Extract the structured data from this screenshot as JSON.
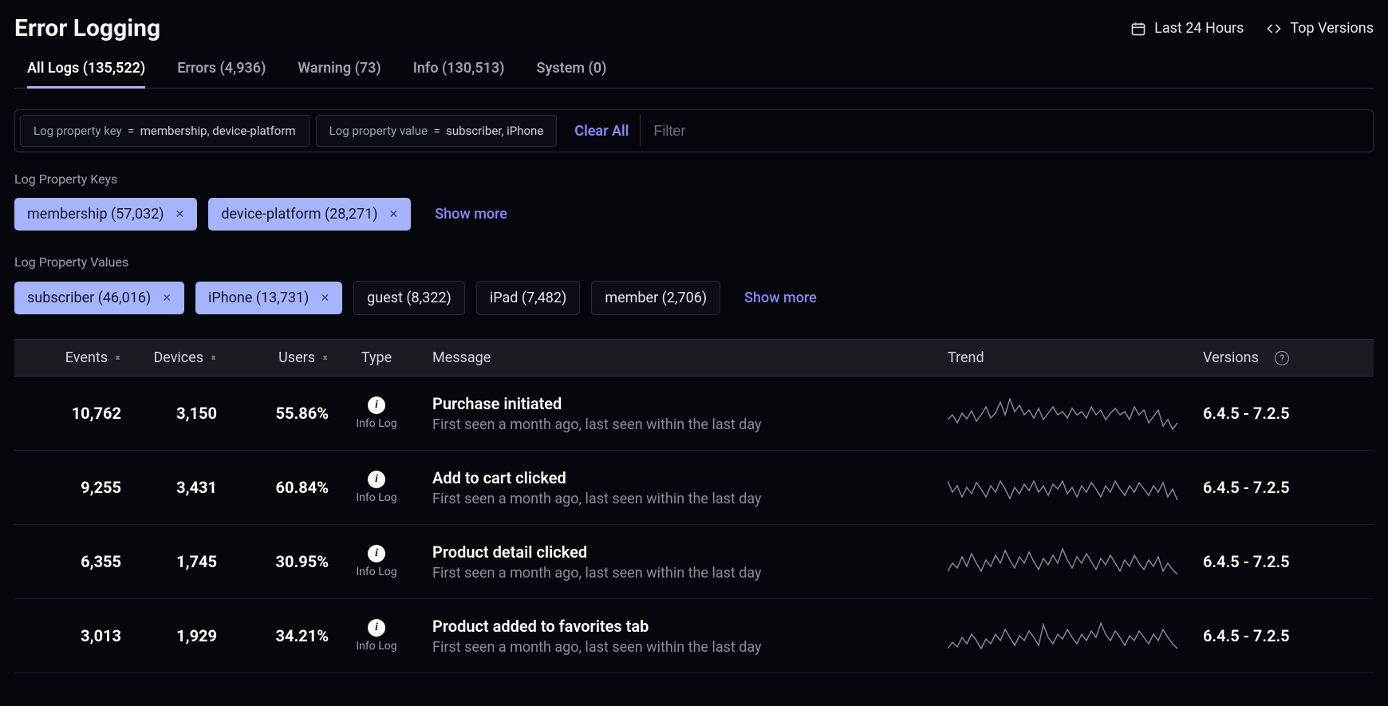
{
  "header": {
    "title": "Error Logging",
    "time_range_label": "Last 24 Hours",
    "versions_label": "Top Versions"
  },
  "tabs": [
    {
      "label": "All Logs (135,522)",
      "active": true
    },
    {
      "label": "Errors (4,936)",
      "active": false
    },
    {
      "label": "Warning (73)",
      "active": false
    },
    {
      "label": "Info (130,513)",
      "active": false
    },
    {
      "label": "System (0)",
      "active": false
    }
  ],
  "filter_bar": {
    "chips": [
      {
        "kind": "Log property key",
        "value": "membership, device-platform"
      },
      {
        "kind": "Log property value",
        "value": "subscriber, iPhone"
      }
    ],
    "clear_label": "Clear All",
    "placeholder": "Filter"
  },
  "prop_keys": {
    "label": "Log Property Keys",
    "chips": [
      {
        "text": "membership (57,032)",
        "selected": true
      },
      {
        "text": "device-platform (28,271)",
        "selected": true
      }
    ],
    "show_more": "Show more"
  },
  "prop_values": {
    "label": "Log Property Values",
    "chips": [
      {
        "text": "subscriber (46,016)",
        "selected": true
      },
      {
        "text": "iPhone (13,731)",
        "selected": true
      },
      {
        "text": "guest (8,322)",
        "selected": false
      },
      {
        "text": "iPad (7,482)",
        "selected": false
      },
      {
        "text": "member (2,706)",
        "selected": false
      }
    ],
    "show_more": "Show more"
  },
  "table": {
    "columns": {
      "events": "Events",
      "devices": "Devices",
      "users": "Users",
      "type": "Type",
      "message": "Message",
      "trend": "Trend",
      "versions": "Versions"
    },
    "rows": [
      {
        "events": "10,762",
        "devices": "3,150",
        "users": "55.86%",
        "type_label": "Info Log",
        "msg_title": "Purchase initiated",
        "msg_sub": "First seen a month ago, last seen within the last day",
        "versions": "6.4.5 - 7.2.5"
      },
      {
        "events": "9,255",
        "devices": "3,431",
        "users": "60.84%",
        "type_label": "Info Log",
        "msg_title": "Add to cart clicked",
        "msg_sub": "First seen a month ago, last seen within the last day",
        "versions": "6.4.5 - 7.2.5"
      },
      {
        "events": "6,355",
        "devices": "1,745",
        "users": "30.95%",
        "type_label": "Info Log",
        "msg_title": "Product detail clicked",
        "msg_sub": "First seen a month ago, last seen within the last day",
        "versions": "6.4.5 - 7.2.5"
      },
      {
        "events": "3,013",
        "devices": "1,929",
        "users": "34.21%",
        "type_label": "Info Log",
        "msg_title": "Product added to favorites tab",
        "msg_sub": "First seen a month ago, last seen within the last day",
        "versions": "6.4.5 - 7.2.5"
      }
    ]
  }
}
